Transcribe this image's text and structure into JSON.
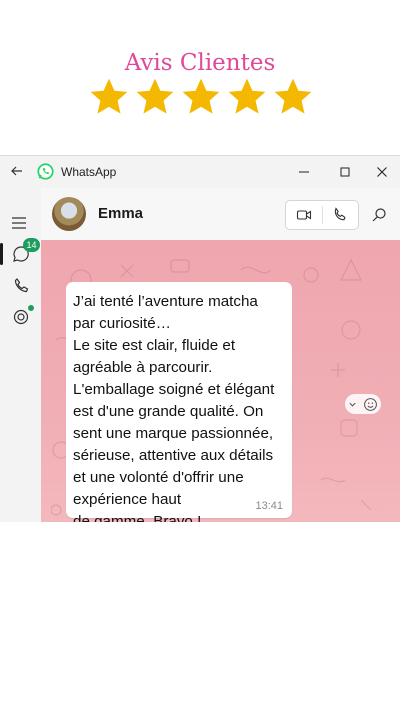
{
  "banner": {
    "title": "Avis Clientes",
    "rating": 5,
    "star_color": "#f5b800"
  },
  "window": {
    "app_name": "WhatsApp",
    "unread_badge": "14",
    "accent_color": "#1d9e5e"
  },
  "chat": {
    "contact_name": "Emma",
    "message": {
      "text": "J’ai tenté l’aventure matcha par curiosité…\nLe site est clair, fluide et agréable à parcourir. L'emballage soigné et élégant est d'une grande qualité. On sent une marque passionnée, sérieuse, attentive aux détails et une volonté d'offrir une expérience haut\nde gamme. Bravo !",
      "time": "13:41"
    },
    "wallpaper_color": "#f0a6ae"
  }
}
